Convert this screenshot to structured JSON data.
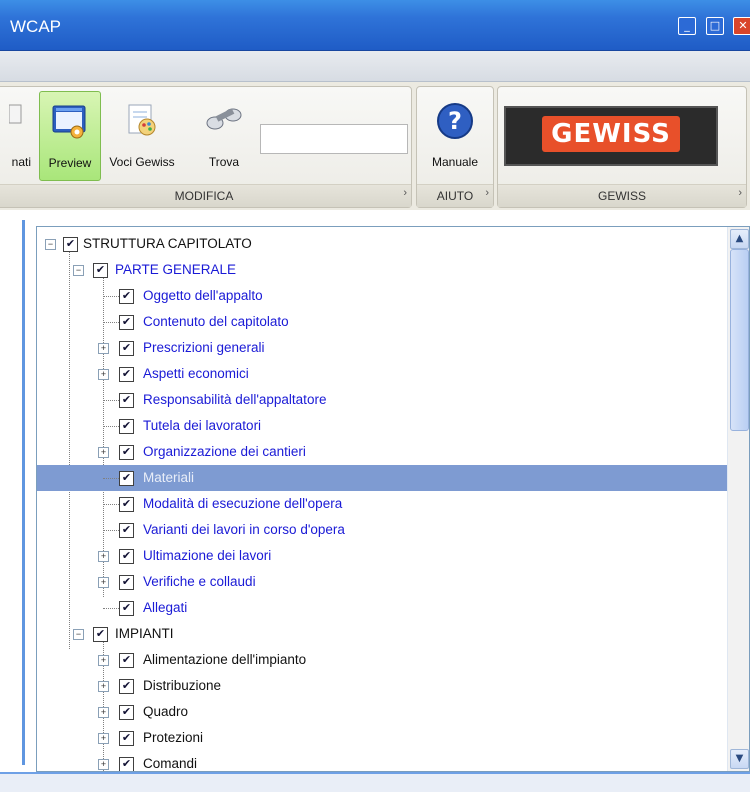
{
  "window": {
    "title": "WCAP"
  },
  "ribbon": {
    "partial_label": "nati",
    "preview_label": "Preview",
    "voci_label": "Voci Gewiss",
    "trova_label": "Trova",
    "manuale_label": "Manuale",
    "groups": {
      "modifica": "MODIFICA",
      "aiuto": "AIUTO",
      "gewiss": "GEWISS"
    },
    "logo_text": "GEWISS",
    "search_value": ""
  },
  "tree": {
    "root": "STRUTTURA CAPITOLATO",
    "parte_generale": "PARTE GENERALE",
    "items_pg": [
      "Oggetto dell'appalto",
      "Contenuto del capitolato",
      "Prescrizioni generali",
      "Aspetti economici",
      "Responsabilità dell'appaltatore",
      "Tutela dei lavoratori",
      "Organizzazione dei cantieri",
      "Materiali",
      "Modalità di esecuzione dell'opera",
      "Varianti dei lavori in corso d'opera",
      "Ultimazione dei lavori",
      "Verifiche e collaudi",
      "Allegati"
    ],
    "impianti": "IMPIANTI",
    "items_imp": [
      "Alimentazione dell'impianto",
      "Distribuzione",
      "Quadro",
      "Protezioni",
      "Comandi"
    ]
  },
  "colors": {
    "title_blue": "#2f73d8",
    "selection": "#7e9bd2",
    "preview_green": "#a9e67a",
    "logo_orange": "#e8502a"
  },
  "icons": {
    "preview": "preview-window-icon",
    "voci": "document-palette-icon",
    "trova": "binoculars-icon",
    "manuale": "help-question-icon"
  }
}
